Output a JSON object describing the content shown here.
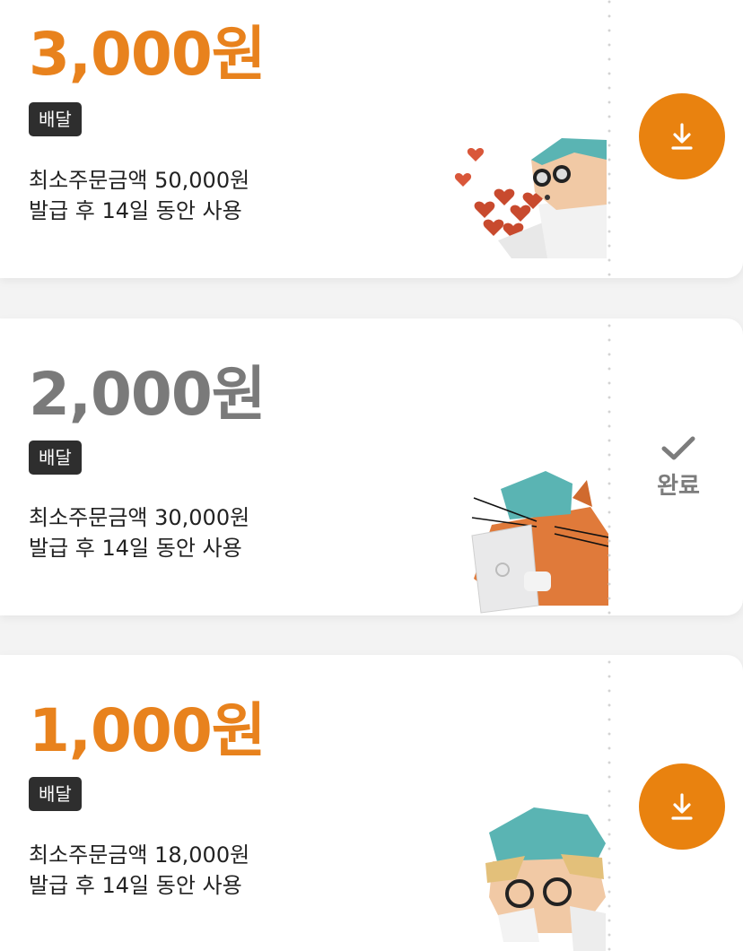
{
  "coupons": [
    {
      "amount": "3,000원",
      "badge": "배달",
      "min_order": "최소주문금액 50,000원",
      "validity": "발급 후 14일 동안 사용",
      "state": "download",
      "action_icon": "download-icon"
    },
    {
      "amount": "2,000원",
      "badge": "배달",
      "min_order": "최소주문금액 30,000원",
      "validity": "발급 후 14일 동안 사용",
      "state": "done",
      "action_icon": "check-icon",
      "done_label": "완료"
    },
    {
      "amount": "1,000원",
      "badge": "배달",
      "min_order": "최소주문금액 18,000원",
      "validity": "발급 후 14일 동안 사용",
      "state": "download",
      "action_icon": "download-icon"
    }
  ],
  "colors": {
    "accent": "#e8821d",
    "done_gray": "#7a7a7a",
    "badge_bg": "#2e2e2e",
    "background": "#f3f3f3"
  }
}
